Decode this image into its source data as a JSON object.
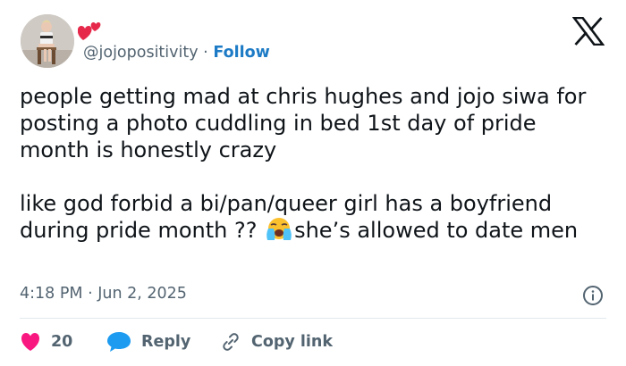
{
  "author": {
    "handle": "@jojopositivity",
    "separator": "·",
    "follow_label": "Follow",
    "name_emoji": "hearts-emoji"
  },
  "tweet": {
    "paragraph_1": "people getting mad at chris hughes and jojo siwa for posting a photo cuddling in bed 1st day of pride month is honestly crazy",
    "paragraph_2_before_emoji": "like god forbid a bi/pan/queer girl has a boyfriend during pride month ??",
    "paragraph_2_after_emoji": "she’s allowed to date men",
    "inline_emoji": "loudly-crying-face-emoji"
  },
  "meta": {
    "timestamp": "4:18 PM · Jun 2, 2025"
  },
  "actions": {
    "like_count": "20",
    "reply_label": "Reply",
    "copy_link_label": "Copy link"
  },
  "colors": {
    "text": "#0f1419",
    "secondary": "#536471",
    "follow": "#1d7bc6",
    "like": "#f91880",
    "reply": "#1d9bf0",
    "divider": "#e1e8ed"
  }
}
